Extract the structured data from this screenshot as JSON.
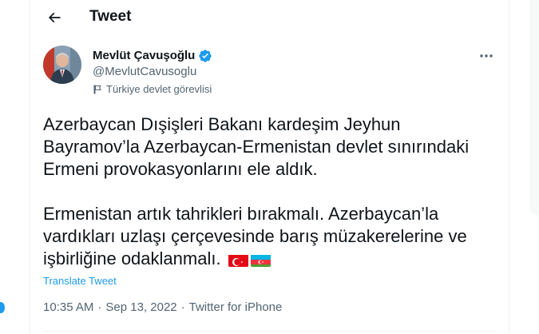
{
  "header": {
    "title": "Tweet"
  },
  "tweet": {
    "display_name": "Mevlüt Çavuşoğlu",
    "handle": "@MevlutCavusoglu",
    "label": "Türkiye devlet görevlisi",
    "paragraph1": "Azerbaycan Dışişleri Bakanı kardeşim Jeyhun Bayramov’la Azerbaycan-Ermenistan devlet sınırındaki Ermeni provokasyonlarını ele aldık.",
    "paragraph2": "Ermenistan artık tahrikleri bırakmalı. Azerbaycan’la vardıkları uzlaşı çerçevesinde barış müzakerelerine ve işbirliğine odaklanmalı.",
    "flags": [
      "turkey-flag",
      "azerbaijan-flag"
    ],
    "translate_label": "Translate Tweet",
    "time": "10:35 AM",
    "separator1": "·",
    "date": "Sep 13, 2022",
    "separator2": "·",
    "source": "Twitter for iPhone"
  },
  "colors": {
    "accent": "#1d9bf0",
    "secondary_text": "#536471",
    "primary_text": "#0f1419",
    "verified": "#1d9bf0"
  }
}
